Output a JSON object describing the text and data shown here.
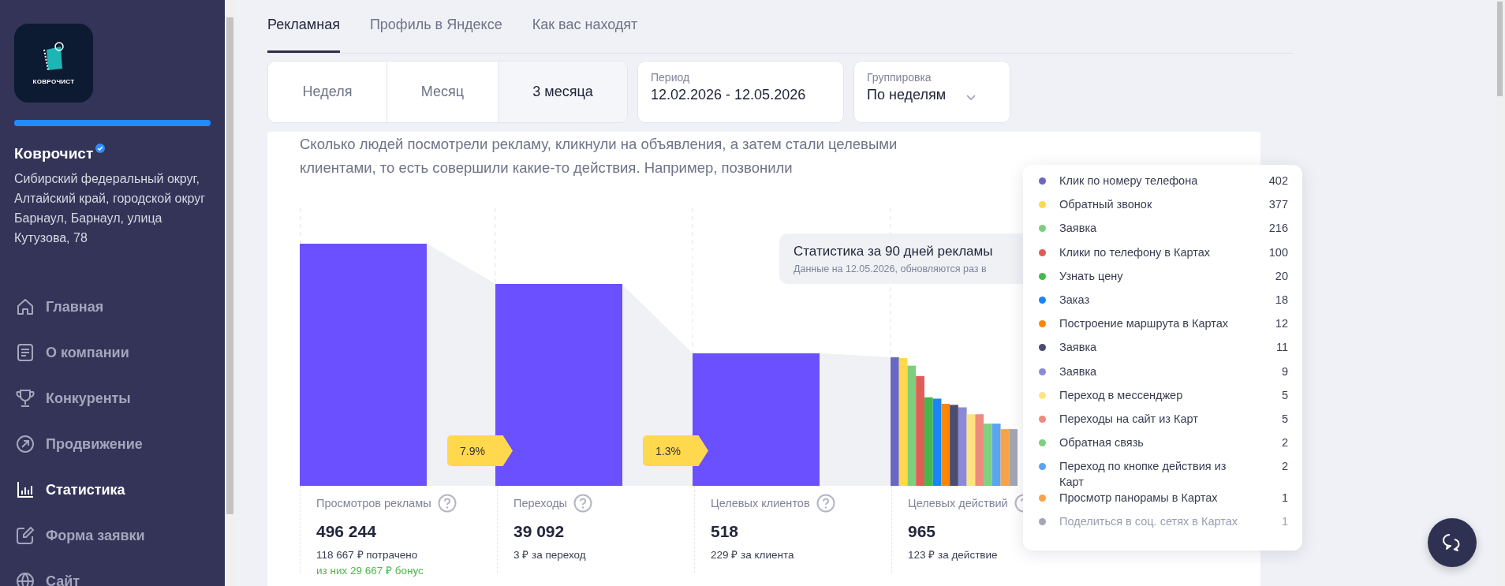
{
  "company": {
    "name": "Коврочист",
    "logo_text": "КОВРОЧИСТ",
    "verified": true,
    "profile_progress": {
      "level": 1
    },
    "address": "Сибирский федеральный округ, Алтайский край, городской округ Барнаул, Барнаул, улица Кутузова, 78"
  },
  "sidebar": {
    "items": [
      {
        "label": "Главная",
        "kind": "home",
        "selected": false
      },
      {
        "label": "О компании",
        "kind": "about",
        "selected": false
      },
      {
        "label": "Конкуренты",
        "kind": "rivals",
        "selected": false
      },
      {
        "label": "Продвижение",
        "kind": "promo",
        "selected": false
      },
      {
        "label": "Статистика",
        "kind": "stats",
        "selected": true
      },
      {
        "label": "Форма заявки",
        "kind": "form",
        "selected": false
      },
      {
        "label": "Сайт",
        "kind": "site",
        "selected": false
      }
    ]
  },
  "tabs": [
    {
      "label": "Рекламная",
      "selected": true
    },
    {
      "label": "Профиль в Яндексе",
      "selected": false
    },
    {
      "label": "Как вас находят",
      "selected": false
    }
  ],
  "periods": [
    {
      "label": "Неделя",
      "selected": false
    },
    {
      "label": "Месяц",
      "selected": false
    },
    {
      "label": "3 месяца",
      "selected": true
    }
  ],
  "period_field": {
    "label": "Период",
    "value": "12.02.2026 - 12.05.2026"
  },
  "grouping": {
    "label": "Группировка",
    "value": "По неделям"
  },
  "description": "Сколько людей посмотрели рекламу, кликнули на объявления, а затем стали целевыми клиентами, то есть совершили какие-то действия. Например, позвонили",
  "conversions": [
    "7.9%",
    "1.3%"
  ],
  "tooltip": {
    "title": "Статистика за 90 дней рекламы",
    "subtitle": "Данные на 12.05.2026, обновляются раз в"
  },
  "stats": [
    {
      "label": "Просмотров рекламы",
      "value": "496 244",
      "detail": "118 667 ₽ потрачено",
      "note": "из них 29 667 ₽ бонус"
    },
    {
      "label": "Переходы",
      "value": "39 092",
      "detail": "3 ₽ за переход"
    },
    {
      "label": "Целевых клиентов",
      "value": "518",
      "detail": "229 ₽ за клиента"
    },
    {
      "label": "Целевых действий",
      "value": "965",
      "detail": "123 ₽ за действие"
    }
  ],
  "actions": [
    {
      "label": "Клик по номеру телефона",
      "count": "402",
      "color": "#6a67c4",
      "muted": false
    },
    {
      "label": "Обратный звонок",
      "count": "377",
      "color": "#ffd84d",
      "muted": false
    },
    {
      "label": "Заявка",
      "count": "216",
      "color": "#7ccf7c",
      "muted": false
    },
    {
      "label": "Клики по телефону в Картах",
      "count": "100",
      "color": "#e05d56",
      "muted": false
    },
    {
      "label": "Узнать цену",
      "count": "20",
      "color": "#45b84a",
      "muted": false
    },
    {
      "label": "Заказ",
      "count": "18",
      "color": "#1a86f5",
      "muted": false
    },
    {
      "label": "Построение маршрута в Картах",
      "count": "12",
      "color": "#ff8600",
      "muted": false
    },
    {
      "label": "Заявка",
      "count": "11",
      "color": "#4a4d6e",
      "muted": false
    },
    {
      "label": "Заявка",
      "count": "9",
      "color": "#8c8ad6",
      "muted": false
    },
    {
      "label": "Переход в мессенджер",
      "count": "5",
      "color": "#ffe380",
      "muted": false
    },
    {
      "label": "Переходы на сайт из Карт",
      "count": "5",
      "color": "#ef8a7e",
      "muted": false
    },
    {
      "label": "Обратная связь",
      "count": "2",
      "color": "#7fd07f",
      "muted": false
    },
    {
      "label": "Переход по кнопке действия из Карт",
      "count": "2",
      "color": "#5aa4f2",
      "muted": false
    },
    {
      "label": "Просмотр панорамы в Картах",
      "count": "1",
      "color": "#f8a24a",
      "muted": false
    },
    {
      "label": "Поделиться в соц. сетях в Картах",
      "count": "1",
      "color": "#a3a7b3",
      "muted": true
    }
  ]
}
